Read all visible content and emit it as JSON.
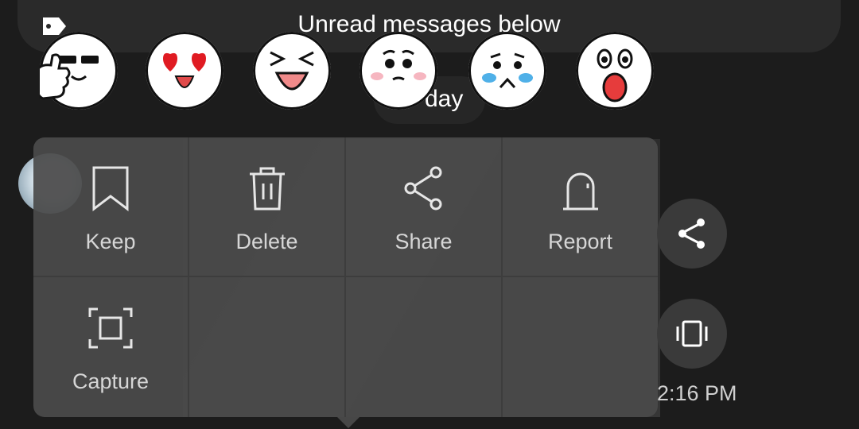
{
  "banner": {
    "text": "Unread messages below",
    "icon": "tag-icon"
  },
  "date_chip": {
    "text": "day"
  },
  "stickers": [
    "thumbs-up-sticker",
    "heart-eyes-sticker",
    "laughing-sticker",
    "pleading-sticker",
    "crying-sticker",
    "shocked-sticker"
  ],
  "menu": {
    "items": [
      {
        "label": "Keep",
        "icon": "bookmark-icon"
      },
      {
        "label": "Delete",
        "icon": "trash-icon"
      },
      {
        "label": "Share",
        "icon": "share-icon"
      },
      {
        "label": "Report",
        "icon": "report-icon"
      },
      {
        "label": "Capture",
        "icon": "capture-icon"
      }
    ]
  },
  "side_actions": [
    {
      "icon": "share-icon"
    },
    {
      "icon": "vibrate-icon"
    }
  ],
  "message_time": "2:16 PM",
  "colors": {
    "background": "#1c1c1c",
    "menu": "#4a4a4a",
    "label": "#d6d6d6"
  }
}
